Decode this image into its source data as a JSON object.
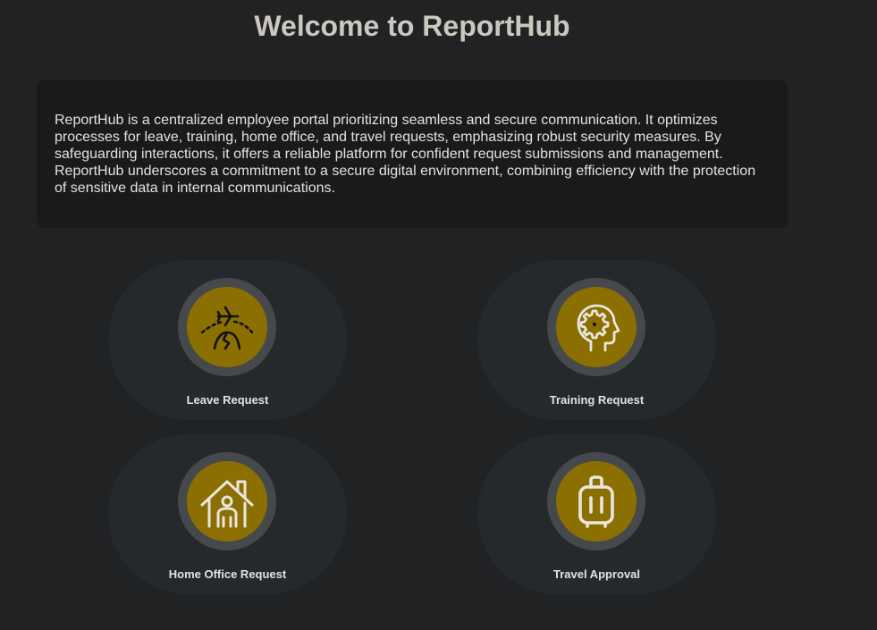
{
  "header": {
    "title": "Welcome to ReportHub"
  },
  "about": {
    "text": "ReportHub is a centralized employee portal prioritizing seamless and secure communication. It optimizes processes for leave, training, home office, and travel requests, emphasizing robust security measures. By safeguarding interactions, it offers a reliable platform for confident request submissions and management. ReportHub underscores a commitment to a secure digital environment, combining efficiency with the protection of sensitive data in internal communications."
  },
  "cards": [
    {
      "label": "Leave Request",
      "icon": "plane-horizon-icon"
    },
    {
      "label": "Training Request",
      "icon": "head-gear-icon"
    },
    {
      "label": "Home Office Request",
      "icon": "house-person-icon"
    },
    {
      "label": "Travel Approval",
      "icon": "luggage-icon"
    }
  ],
  "colors": {
    "background": "#202224",
    "panel": "#191a1c",
    "card": "#26292c",
    "ring": "#46494c",
    "accent": "#8b6f00",
    "title": "#cdc8bf",
    "text": "#e4e2de"
  }
}
